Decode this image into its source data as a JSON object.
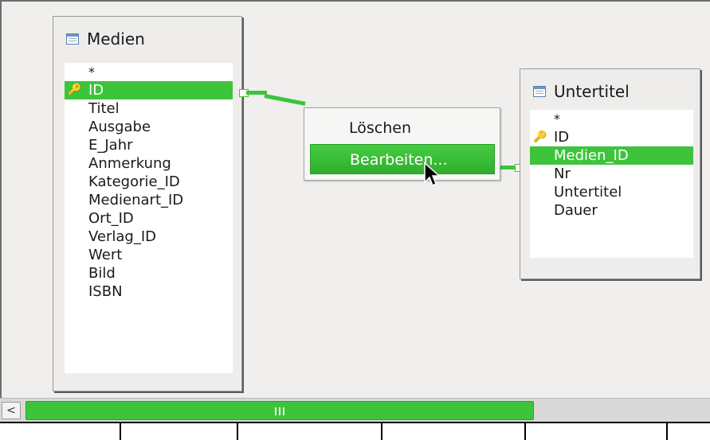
{
  "tables": {
    "medien": {
      "title": "Medien",
      "fields": [
        "*",
        "ID",
        "Titel",
        "Ausgabe",
        "E_Jahr",
        "Anmerkung",
        "Kategorie_ID",
        "Medienart_ID",
        "Ort_ID",
        "Verlag_ID",
        "Wert",
        "Bild",
        "ISBN"
      ],
      "selected_field": "ID",
      "primary_key": "ID"
    },
    "untertitel": {
      "title": "Untertitel",
      "fields": [
        "*",
        "ID",
        "Medien_ID",
        "Nr",
        "Untertitel",
        "Dauer"
      ],
      "selected_field": "Medien_ID",
      "primary_key": "ID"
    }
  },
  "context_menu": {
    "items": [
      "Löschen",
      "Bearbeiten..."
    ],
    "hovered": "Bearbeiten..."
  },
  "scrollbar": {
    "left_arrow": "<",
    "grip": "III"
  },
  "colors": {
    "accent": "#3ec43b",
    "key_icon": "#d4a017",
    "canvas": "#f0efed"
  },
  "icons": [
    "table-icon",
    "primary-key-icon",
    "mouse-pointer-icon",
    "scroll-left-arrow-icon"
  ]
}
